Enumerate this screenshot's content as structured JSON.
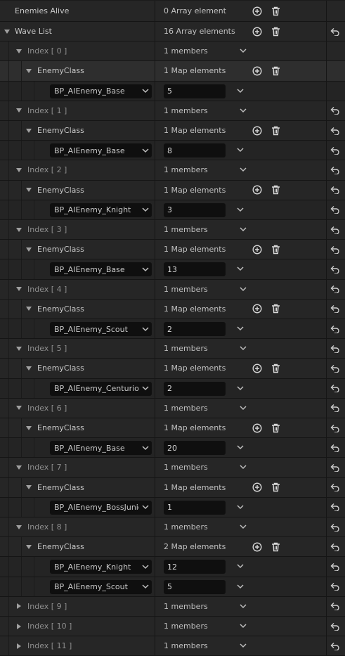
{
  "top": {
    "enemies_alive_label": "Enemies Alive",
    "enemies_alive_value": "0 Array element",
    "wave_list_label": "Wave List",
    "wave_list_value": "16 Array elements"
  },
  "waves": [
    {
      "index": "Index [ 0 ]",
      "members": "1 members",
      "expanded": true,
      "map_label": "EnemyClass",
      "map_value": "1 Map elements",
      "entries": [
        {
          "enemy": "BP_AIEnemy_Base",
          "count": "5"
        }
      ]
    },
    {
      "index": "Index [ 1 ]",
      "members": "1 members",
      "expanded": true,
      "map_label": "EnemyClass",
      "map_value": "1 Map elements",
      "entries": [
        {
          "enemy": "BP_AIEnemy_Base",
          "count": "8"
        }
      ]
    },
    {
      "index": "Index [ 2 ]",
      "members": "1 members",
      "expanded": true,
      "map_label": "EnemyClass",
      "map_value": "1 Map elements",
      "entries": [
        {
          "enemy": "BP_AIEnemy_Knight",
          "count": "3"
        }
      ]
    },
    {
      "index": "Index [ 3 ]",
      "members": "1 members",
      "expanded": true,
      "map_label": "EnemyClass",
      "map_value": "1 Map elements",
      "entries": [
        {
          "enemy": "BP_AIEnemy_Base",
          "count": "13"
        }
      ]
    },
    {
      "index": "Index [ 4 ]",
      "members": "1 members",
      "expanded": true,
      "map_label": "EnemyClass",
      "map_value": "1 Map elements",
      "entries": [
        {
          "enemy": "BP_AIEnemy_Scout",
          "count": "2"
        }
      ]
    },
    {
      "index": "Index [ 5 ]",
      "members": "1 members",
      "expanded": true,
      "map_label": "EnemyClass",
      "map_value": "1 Map elements",
      "entries": [
        {
          "enemy": "BP_AIEnemy_Centurion",
          "count": "2"
        }
      ]
    },
    {
      "index": "Index [ 6 ]",
      "members": "1 members",
      "expanded": true,
      "map_label": "EnemyClass",
      "map_value": "1 Map elements",
      "entries": [
        {
          "enemy": "BP_AIEnemy_Base",
          "count": "20"
        }
      ]
    },
    {
      "index": "Index [ 7 ]",
      "members": "1 members",
      "expanded": true,
      "map_label": "EnemyClass",
      "map_value": "1 Map elements",
      "entries": [
        {
          "enemy": "BP_AIEnemy_BossJunior",
          "count": "1"
        }
      ]
    },
    {
      "index": "Index [ 8 ]",
      "members": "1 members",
      "expanded": true,
      "map_label": "EnemyClass",
      "map_value": "2 Map elements",
      "entries": [
        {
          "enemy": "BP_AIEnemy_Knight",
          "count": "12"
        },
        {
          "enemy": "BP_AIEnemy_Scout",
          "count": "5"
        }
      ]
    },
    {
      "index": "Index [ 9 ]",
      "members": "1 members",
      "expanded": false
    },
    {
      "index": "Index [ 10 ]",
      "members": "1 members",
      "expanded": false
    },
    {
      "index": "Index [ 11 ]",
      "members": "1 members",
      "expanded": false
    }
  ],
  "icons": {
    "add": "add-element-icon",
    "delete": "delete-icon",
    "reset": "reset-to-default-icon",
    "collapse": "chevron-down-icon",
    "expand": "chevron-right-icon"
  }
}
